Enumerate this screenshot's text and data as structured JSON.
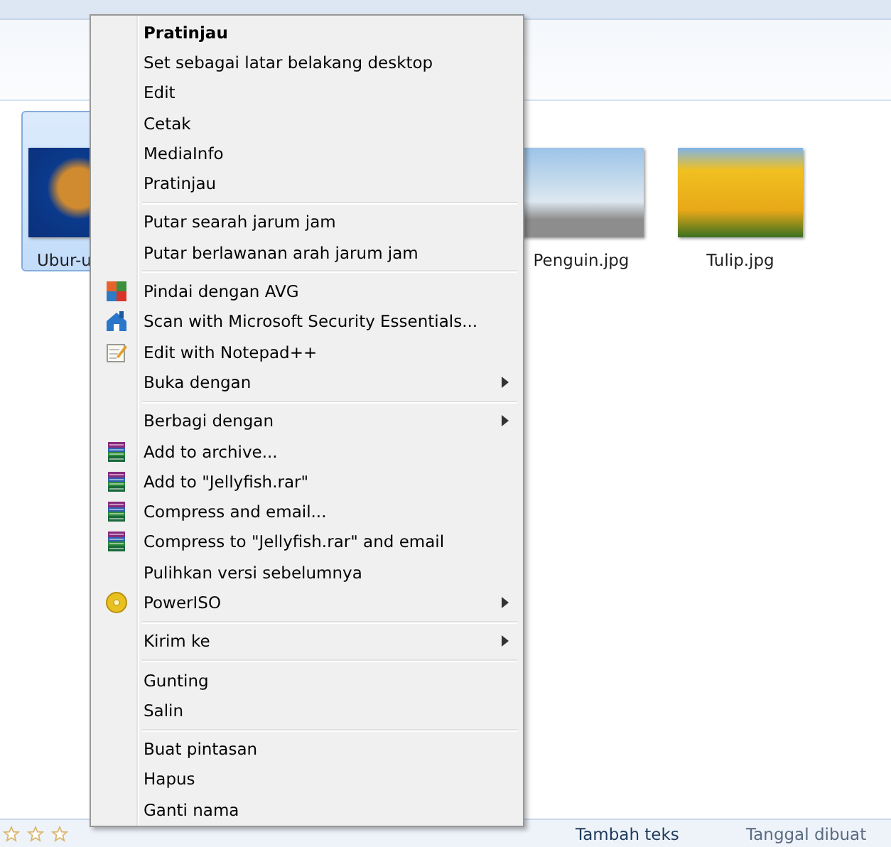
{
  "files": [
    {
      "name": "Ubur-u",
      "selected": true
    },
    {
      "name": "Penguin.jpg",
      "selected": false
    },
    {
      "name": "Tulip.jpg",
      "selected": false
    }
  ],
  "status_bar": {
    "stars": 0,
    "tag_value": "Tambah teks",
    "date_label": "Tanggal dibuat"
  },
  "context_menu": {
    "groups": [
      [
        {
          "label": "Pratinjau",
          "default": true,
          "submenu": false,
          "kind": "plain"
        },
        {
          "label": "Set sebagai latar belakang desktop",
          "default": false,
          "submenu": false,
          "kind": "plain"
        },
        {
          "label": "Edit",
          "default": false,
          "submenu": false,
          "kind": "plain"
        },
        {
          "label": "Cetak",
          "default": false,
          "submenu": false,
          "kind": "plain"
        },
        {
          "label": "MediaInfo",
          "default": false,
          "submenu": false,
          "kind": "plain"
        },
        {
          "label": "Pratinjau",
          "default": false,
          "submenu": false,
          "kind": "plain"
        }
      ],
      [
        {
          "label": "Putar searah jarum jam",
          "default": false,
          "submenu": false,
          "kind": "plain"
        },
        {
          "label": "Putar berlawanan arah jarum jam",
          "default": false,
          "submenu": false,
          "kind": "plain"
        }
      ],
      [
        {
          "label": "Pindai dengan AVG",
          "default": false,
          "submenu": false,
          "kind": "antivirus"
        },
        {
          "label": "Scan with Microsoft Security Essentials...",
          "default": false,
          "submenu": false,
          "kind": "security"
        },
        {
          "label": "Edit with Notepad++",
          "default": false,
          "submenu": false,
          "kind": "editor"
        },
        {
          "label": "Buka dengan",
          "default": false,
          "submenu": true,
          "kind": "plain"
        }
      ],
      [
        {
          "label": "Berbagi dengan",
          "default": false,
          "submenu": true,
          "kind": "plain"
        },
        {
          "label": "Add to archive...",
          "default": false,
          "submenu": false,
          "kind": "archive"
        },
        {
          "label": "Add to \"Jellyfish.rar\"",
          "default": false,
          "submenu": false,
          "kind": "archive"
        },
        {
          "label": "Compress and email...",
          "default": false,
          "submenu": false,
          "kind": "archive"
        },
        {
          "label": "Compress to \"Jellyfish.rar\" and email",
          "default": false,
          "submenu": false,
          "kind": "archive"
        },
        {
          "label": "Pulihkan versi sebelumnya",
          "default": false,
          "submenu": false,
          "kind": "plain"
        },
        {
          "label": "PowerISO",
          "default": false,
          "submenu": true,
          "kind": "disc"
        }
      ],
      [
        {
          "label": "Kirim ke",
          "default": false,
          "submenu": true,
          "kind": "plain"
        }
      ],
      [
        {
          "label": "Gunting",
          "default": false,
          "submenu": false,
          "kind": "plain"
        },
        {
          "label": "Salin",
          "default": false,
          "submenu": false,
          "kind": "plain"
        }
      ],
      [
        {
          "label": "Buat pintasan",
          "default": false,
          "submenu": false,
          "kind": "plain"
        },
        {
          "label": "Hapus",
          "default": false,
          "submenu": false,
          "kind": "plain"
        },
        {
          "label": "Ganti nama",
          "default": false,
          "submenu": false,
          "kind": "plain"
        }
      ]
    ]
  }
}
